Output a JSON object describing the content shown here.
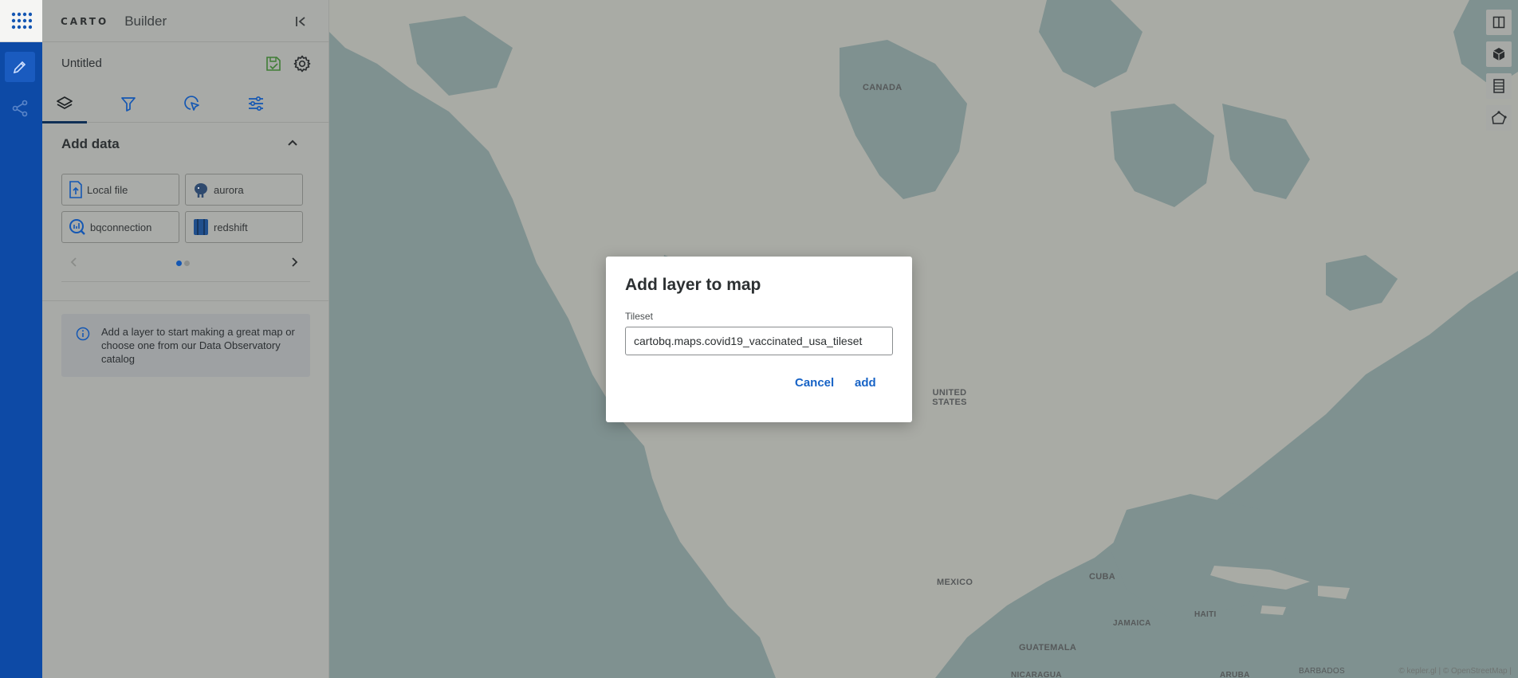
{
  "app": {
    "logo_text": "CARTO",
    "product": "Builder"
  },
  "map_title": "Untitled",
  "add_data": {
    "title": "Add data",
    "sources": [
      {
        "label": "Local file",
        "icon": "upload-file-icon"
      },
      {
        "label": "aurora",
        "icon": "postgres-elephant-icon"
      },
      {
        "label": "bqconnection",
        "icon": "bigquery-icon"
      },
      {
        "label": "redshift",
        "icon": "redshift-icon"
      }
    ],
    "page": 1,
    "page_count": 2
  },
  "info": {
    "text": "Add a layer to start making a great map or choose one from our Data Observatory catalog"
  },
  "map_labels": {
    "canada": "CANADA",
    "united_states": "UNITED STATES",
    "mexico": "MEXICO",
    "cuba": "CUBA",
    "haiti": "HAITI",
    "jamaica": "JAMAICA",
    "guatemala": "GUATEMALA",
    "nicaragua": "NICARAGUA",
    "aruba": "ARUBA",
    "barbados": "BARBADOS"
  },
  "attribution": "© kepler.gl | © OpenStreetMap |",
  "dialog": {
    "title": "Add layer to map",
    "field_label": "Tileset",
    "field_value": "cartobq.maps.covid19_vaccinated_usa_tileset",
    "cancel_label": "Cancel",
    "add_label": "add"
  },
  "colors": {
    "accent": "#1763c6",
    "rail": "#0d4aa6",
    "map_water": "#7f9190",
    "map_land": "#a9aba5"
  }
}
